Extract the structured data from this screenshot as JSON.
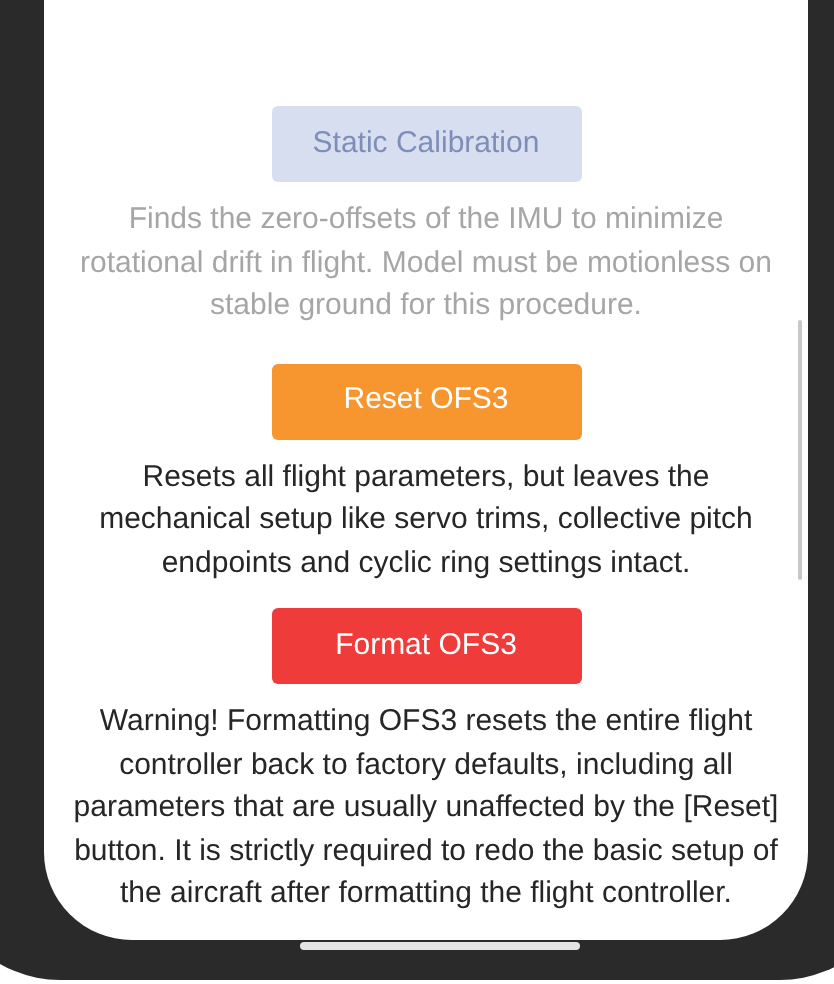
{
  "actions": [
    {
      "label": "Static Calibration",
      "disabled": true,
      "color": "#d6deef",
      "description": "Finds the zero-offsets of the IMU to minimize rotational drift in flight. Model must be motionless on stable ground for this procedure."
    },
    {
      "label": "Reset OFS3",
      "disabled": false,
      "color": "#f7962f",
      "description": "Resets all flight parameters, but leaves the mechanical setup like servo trims, collective pitch endpoints and cyclic ring settings intact."
    },
    {
      "label": "Format OFS3",
      "disabled": false,
      "color": "#ef3b39",
      "description": "Warning! Formatting OFS3 resets the entire flight controller back to factory defaults, including all parameters that are usually unaffected by the [Reset] button. It is strictly required to redo the basic setup of the aircraft after formatting the flight controller."
    }
  ]
}
